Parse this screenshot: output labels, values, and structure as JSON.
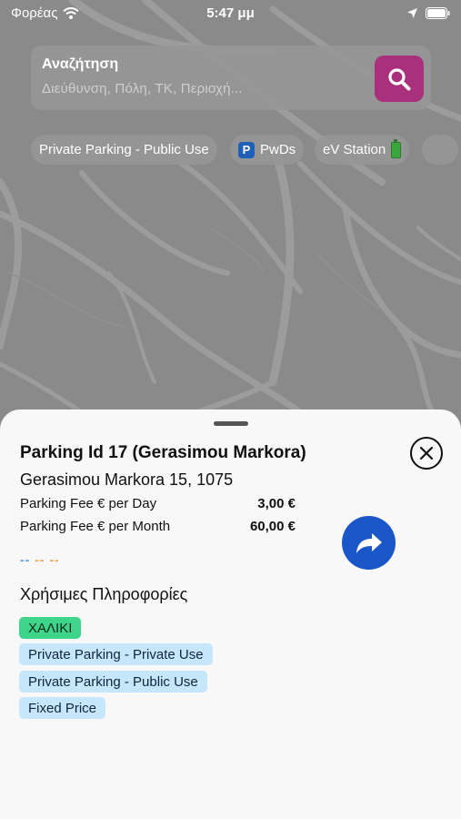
{
  "status_bar": {
    "carrier": "Φορέας",
    "time": "5:47 μμ"
  },
  "search": {
    "title": "Αναζήτηση",
    "placeholder": "Διεύθυνση, Πόλη, ΤΚ, Περιοχή..."
  },
  "filter_chips": [
    {
      "label": "Private Parking - Public Use",
      "icon": ""
    },
    {
      "label": "PwDs",
      "icon": "parking-icon"
    },
    {
      "label": "eV Station",
      "icon": "battery-icon"
    }
  ],
  "parking": {
    "title": "Parking Id 17 (Gerasimou Markora)",
    "address": "Gerasimou Markora 15, 1075",
    "fees": [
      {
        "label": "Parking Fee  € per Day",
        "value": "3,00 €"
      },
      {
        "label": "Parking Fee € per Month",
        "value": "60,00 €"
      }
    ],
    "dashes": [
      "--",
      "--",
      "--"
    ],
    "dash_colors": [
      "#5b9be0",
      "#f0a34a",
      "#f0a34a"
    ]
  },
  "useful_info": {
    "heading": "Χρήσιμες Πληροφορίες",
    "tags": [
      {
        "label": "ΧΑΛΙΚΙ",
        "style": "green"
      },
      {
        "label": "Private Parking - Private Use",
        "style": "blue"
      },
      {
        "label": "Private Parking - Public Use",
        "style": "blue"
      },
      {
        "label": "Fixed Price",
        "style": "blue"
      }
    ]
  },
  "colors": {
    "search_button": "#a8307d",
    "navigate_button": "#1b56c9",
    "tag_green": "#3ed48a",
    "tag_blue": "#c6e6fb"
  }
}
